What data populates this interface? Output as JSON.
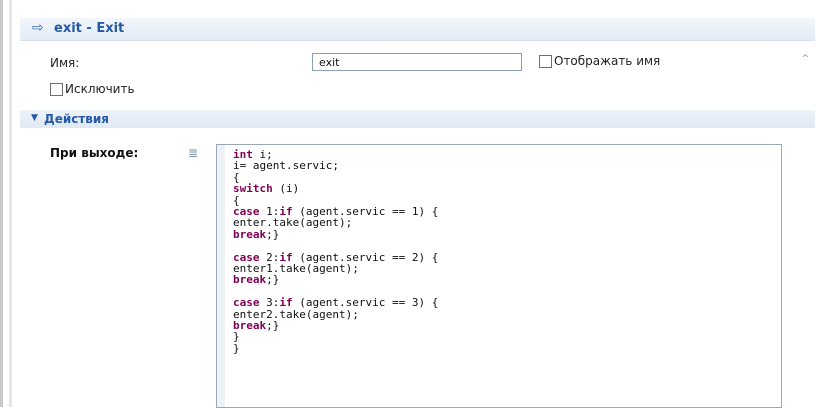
{
  "panel": {
    "title": "exit - Exit",
    "header_icon": "arrow-right-icon"
  },
  "fields": {
    "name_label": "Имя:",
    "name_value": "exit",
    "show_name_label": "Отображать имя",
    "show_name_checked": false,
    "exclude_label": "Исключить",
    "exclude_checked": false
  },
  "actions": {
    "section_title": "Действия",
    "on_exit_label": "При выходе:",
    "code_lines": [
      [
        {
          "t": "int",
          "k": true
        },
        {
          "t": " i;"
        }
      ],
      [
        {
          "t": "i= agent.servic;"
        }
      ],
      [
        {
          "t": "{"
        }
      ],
      [
        {
          "t": "switch",
          "k": true
        },
        {
          "t": " (i)"
        }
      ],
      [
        {
          "t": "{"
        }
      ],
      [
        {
          "t": "case",
          "k": true
        },
        {
          "t": " 1:"
        },
        {
          "t": "if",
          "k": true
        },
        {
          "t": " (agent.servic == 1) {"
        }
      ],
      [
        {
          "t": "enter.take(agent);"
        }
      ],
      [
        {
          "t": "break",
          "k": true
        },
        {
          "t": ";}"
        }
      ],
      [
        {
          "t": ""
        }
      ],
      [
        {
          "t": "case",
          "k": true
        },
        {
          "t": " 2:"
        },
        {
          "t": "if",
          "k": true
        },
        {
          "t": " (agent.servic == 2) {"
        }
      ],
      [
        {
          "t": "enter1.take(agent);"
        }
      ],
      [
        {
          "t": "break",
          "k": true
        },
        {
          "t": ";}"
        }
      ],
      [
        {
          "t": ""
        }
      ],
      [
        {
          "t": "case",
          "k": true
        },
        {
          "t": " 3:"
        },
        {
          "t": "if",
          "k": true
        },
        {
          "t": " (agent.servic == 3) {"
        }
      ],
      [
        {
          "t": "enter2.take(agent);"
        }
      ],
      [
        {
          "t": "break",
          "k": true
        },
        {
          "t": ";}"
        }
      ],
      [
        {
          "t": "}"
        }
      ],
      [
        {
          "t": "}"
        }
      ]
    ]
  },
  "colors": {
    "title_blue": "#2459a8",
    "keyword": "#7f0055"
  }
}
